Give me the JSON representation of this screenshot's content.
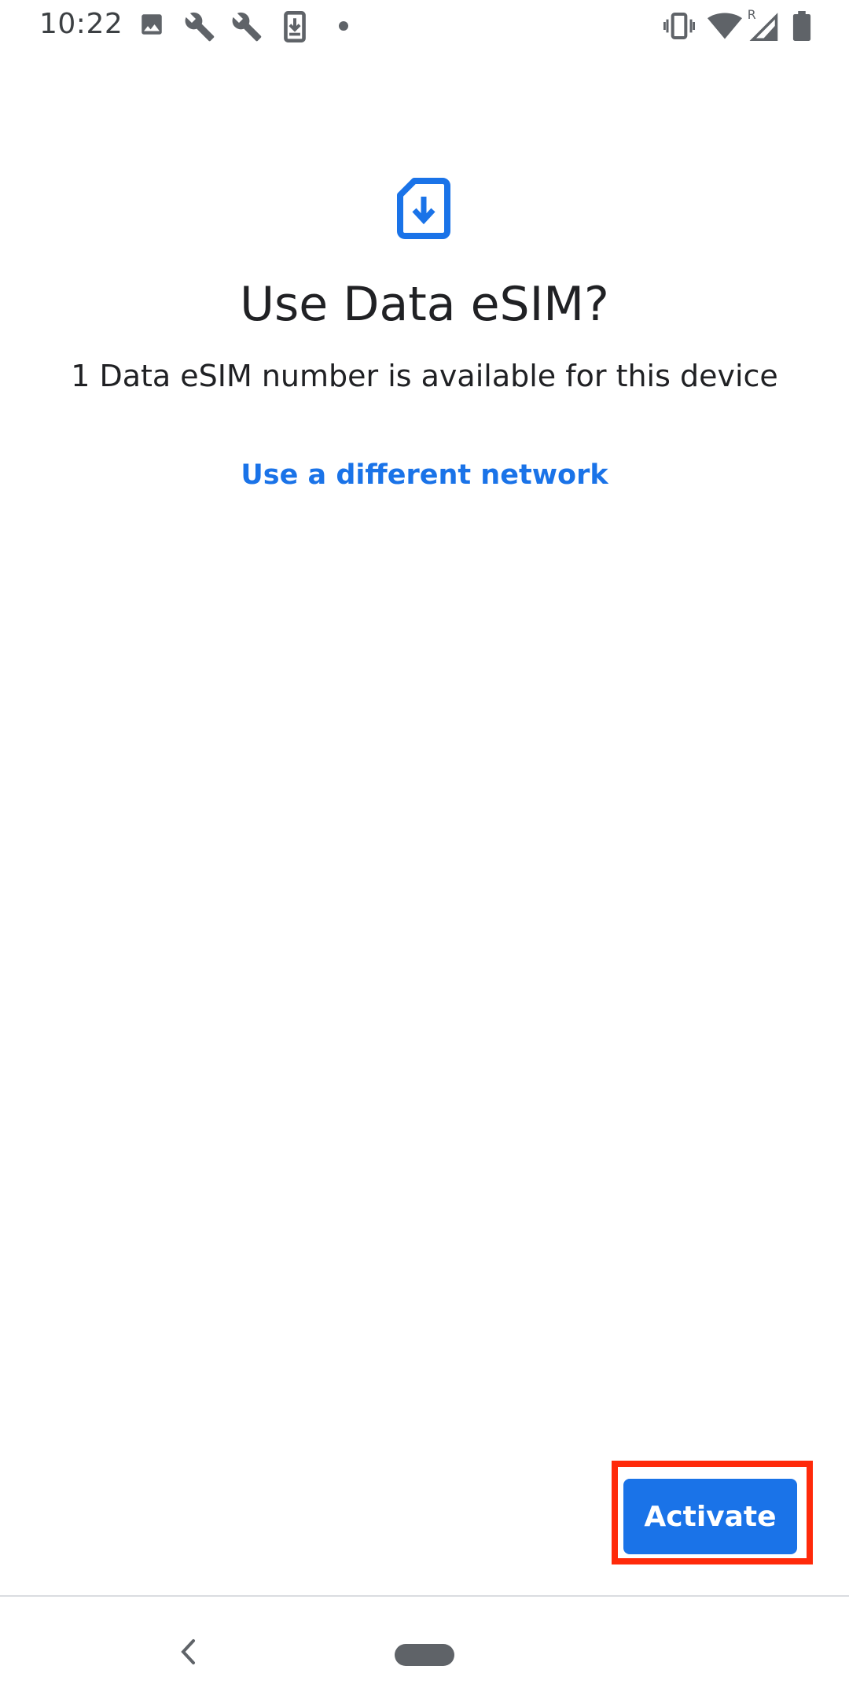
{
  "status_bar": {
    "time": "10:22",
    "icons": [
      "image-icon",
      "wrench-icon",
      "wrench-icon",
      "download-phone-icon",
      "dot-icon",
      "vibrate-icon",
      "wifi-icon",
      "signal-roaming-icon",
      "battery-icon"
    ],
    "roaming_label": "R"
  },
  "content": {
    "icon": "esim-download-icon",
    "title": "Use Data eSIM?",
    "subtitle": "1 Data eSIM number is available for this device",
    "link_label": "Use a different network"
  },
  "actions": {
    "activate_label": "Activate"
  },
  "colors": {
    "accent": "#1a73e8",
    "highlight": "#ff2a0a",
    "text": "#202124",
    "icon": "#5f6368"
  },
  "nav_bar": {
    "icons": [
      "back-icon",
      "home-pill-icon"
    ]
  }
}
